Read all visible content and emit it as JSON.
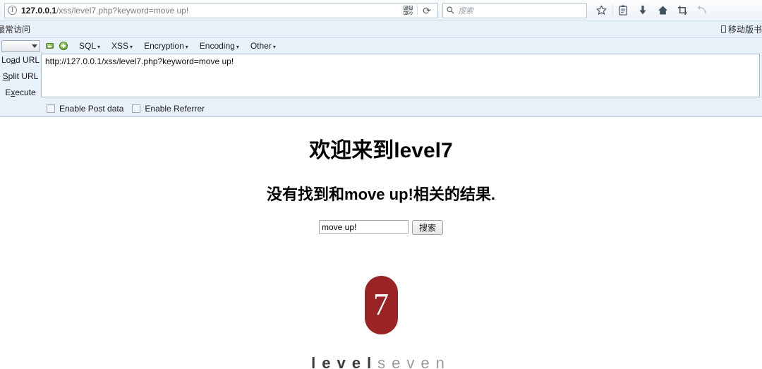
{
  "browser": {
    "urlbar": {
      "info_icon": "info-circle-icon",
      "host": "127.0.0.1",
      "path": "/xss/level7.php?keyword=move up!",
      "qr_icon": "qr-code-icon",
      "reload_icon": "reload-icon",
      "reload_glyph": "⟳"
    },
    "search": {
      "icon": "search-icon",
      "placeholder": "搜索"
    },
    "toolbar_icons": [
      {
        "name": "bookmark-star-icon",
        "glyph": "☆"
      },
      {
        "name": "reading-list-icon",
        "glyph": "▤"
      },
      {
        "name": "downloads-icon",
        "glyph": "⬇"
      },
      {
        "name": "home-icon",
        "glyph": "⌂"
      },
      {
        "name": "screenshot-crop-icon",
        "glyph": "⛶"
      },
      {
        "name": "undo-icon",
        "glyph": "↩"
      }
    ]
  },
  "bookmarks": {
    "most_visited": "最常访问",
    "mobile_bookmarks": "移动版书签"
  },
  "hackbar": {
    "select_value": "",
    "minus_icon": "minus-icon",
    "plus_icon": "plus-icon",
    "menus": [
      {
        "label": "SQL",
        "arrow": "▾"
      },
      {
        "label": "XSS",
        "arrow": "▾"
      },
      {
        "label": "Encryption",
        "arrow": "▾"
      },
      {
        "label": "Encoding",
        "arrow": "▾"
      },
      {
        "label": "Other",
        "arrow": "▾"
      }
    ],
    "buttons": {
      "load_url_pre": "Lo",
      "load_url_key": "a",
      "load_url_post": "d URL",
      "split_url_key": "S",
      "split_url_post": "plit URL",
      "execute_pre": "E",
      "execute_key": "x",
      "execute_post": "ecute"
    },
    "url_value": "http://127.0.0.1/xss/level7.php?keyword=move up!",
    "checkboxes": [
      {
        "label": "Enable Post data",
        "checked": false
      },
      {
        "label": "Enable Referrer",
        "checked": false
      }
    ]
  },
  "page": {
    "welcome_heading": "欢迎来到level7",
    "result_heading": "没有找到和move up!相关的结果.",
    "keyword_value": "move up!",
    "submit_label": "搜索",
    "logo": {
      "number": "7",
      "text_bold": "level",
      "text_light": "seven",
      "pill_color": "#9a2423"
    }
  }
}
